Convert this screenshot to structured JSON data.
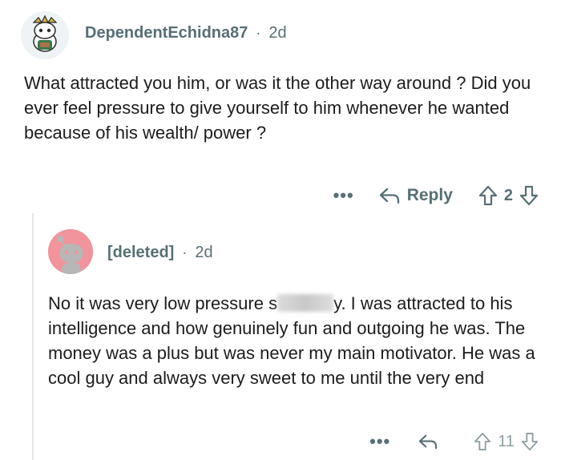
{
  "comments": [
    {
      "author": "DependentEchidna87",
      "time": "2d",
      "text": "What attracted you him, or was it the other way around ? Did you ever feel pressure to give yourself to him whenever he wanted because of his wealth/ power ?",
      "more": "•••",
      "reply_label": "Reply",
      "votes": "2"
    },
    {
      "author": "[deleted]",
      "time": "2d",
      "text_before": "No it was very low pressure s",
      "text_after": "y. I was attracted to his intelligence and how genuinely fun and outgoing he was. The money was a plus but was never my main motivator. He was a cool guy and always very sweet to me until the very end",
      "more": "•••",
      "votes": "11"
    }
  ],
  "separator": "·",
  "icons": {
    "avatar1": "snoo-avatar-icon",
    "avatar2": "deleted-user-avatar-icon",
    "reply": "reply-arrow-icon",
    "upvote": "upvote-arrow-icon",
    "downvote": "downvote-arrow-icon"
  },
  "colors": {
    "meta": "#576f76",
    "deleted_avatar_bg": "#f1949b"
  }
}
